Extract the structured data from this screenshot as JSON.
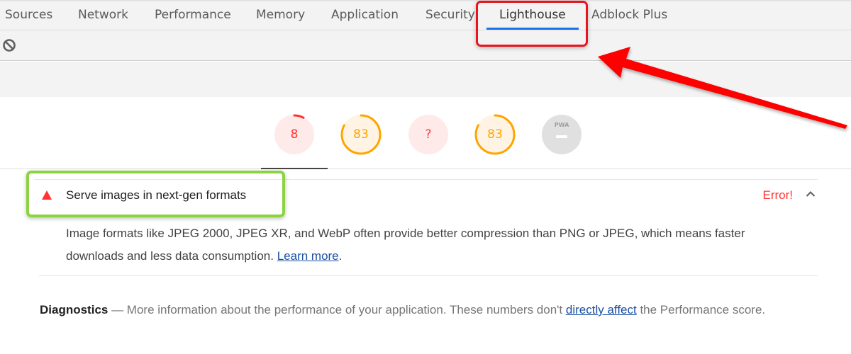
{
  "tabs": [
    {
      "label": "Sources",
      "active": false
    },
    {
      "label": "Network",
      "active": false
    },
    {
      "label": "Performance",
      "active": false
    },
    {
      "label": "Memory",
      "active": false
    },
    {
      "label": "Application",
      "active": false
    },
    {
      "label": "Security",
      "active": false
    },
    {
      "label": "Lighthouse",
      "active": true
    },
    {
      "label": "Adblock Plus",
      "active": false
    }
  ],
  "toolbar": {
    "clear_icon": "block-icon"
  },
  "gauges": [
    {
      "name": "performance",
      "label": "8",
      "score": 8,
      "color": "#ff3333",
      "bg": "#ffeaea"
    },
    {
      "name": "accessibility",
      "label": "83",
      "score": 83,
      "color": "#ffa400",
      "bg": "#fff4e3"
    },
    {
      "name": "best-practices",
      "label": "?",
      "score": null,
      "color": "#ff3333",
      "bg": "#ffeaea"
    },
    {
      "name": "seo",
      "label": "83",
      "score": 83,
      "color": "#ffa400",
      "bg": "#fff4e3"
    },
    {
      "name": "pwa",
      "label": "PWA",
      "score": null,
      "color": "#9e9e9e",
      "bg": "#e0e0e0"
    }
  ],
  "audit": {
    "title": "Serve images in next-gen formats",
    "status": "Error!",
    "status_color": "#ff3333",
    "description": "Image formats like JPEG 2000, JPEG XR, and WebP often provide better compression than PNG or JPEG, which means faster downloads and less data consumption. ",
    "learn_more": "Learn more",
    "trailing": "."
  },
  "diagnostics": {
    "heading": "Diagnostics",
    "text": " — More information about the performance of your application. These numbers don't ",
    "link": "directly affect",
    "trailing": " the Performance score."
  },
  "annotations": {
    "highlight_lighthouse_color": "#e8141e",
    "highlight_audit_color": "#8cd43f",
    "arrow_color": "#ff0000"
  }
}
